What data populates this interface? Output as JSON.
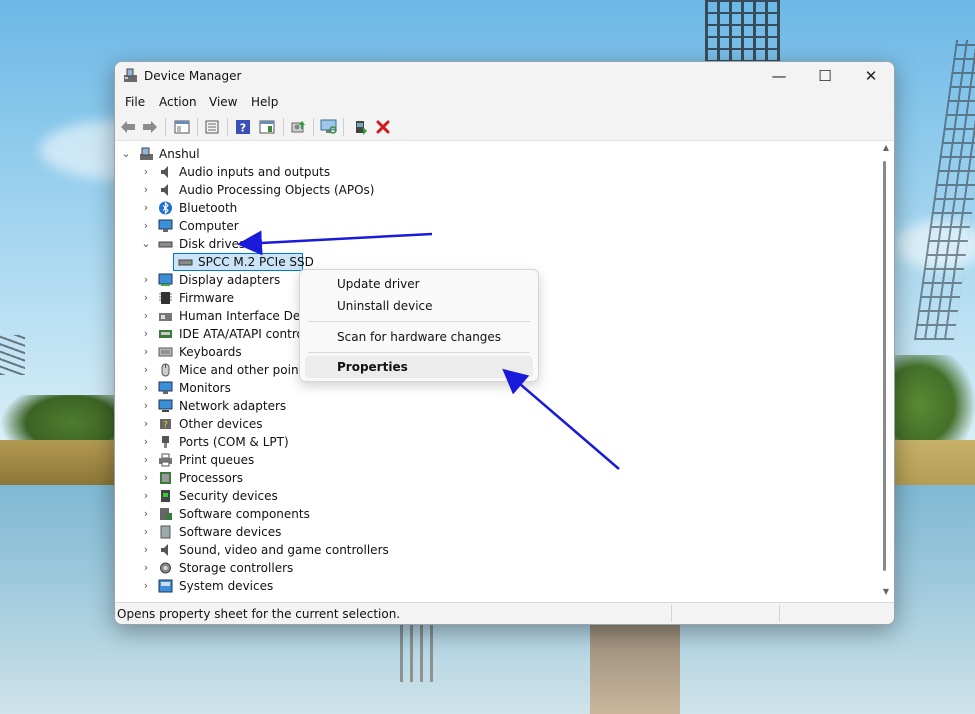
{
  "window": {
    "title": "Device Manager",
    "controls": {
      "minimize": "—",
      "maximize": "☐",
      "close": "✕"
    }
  },
  "menu": [
    "File",
    "Action",
    "View",
    "Help"
  ],
  "toolbar": {
    "buttons": [
      "back-arrow-icon",
      "forward-arrow-icon",
      "show-hide-tree-icon",
      "properties-icon",
      "help-icon",
      "show-hidden-icon",
      "update-driver-icon",
      "scan-hardware-icon",
      "add-driver-icon",
      "uninstall-icon"
    ]
  },
  "tree": {
    "root": "Anshul",
    "items": [
      {
        "label": "Audio inputs and outputs",
        "expanded": false
      },
      {
        "label": "Audio Processing Objects (APOs)",
        "expanded": false
      },
      {
        "label": "Bluetooth",
        "expanded": false
      },
      {
        "label": "Computer",
        "expanded": false
      },
      {
        "label": "Disk drives",
        "expanded": true
      },
      {
        "label": "SPCC M.2 PCIe SSD",
        "child": true,
        "selected": true
      },
      {
        "label": "Display adapters",
        "expanded": false
      },
      {
        "label": "Firmware",
        "expanded": false
      },
      {
        "label": "Human Interface Devic",
        "expanded": false
      },
      {
        "label": "IDE ATA/ATAPI controll",
        "expanded": false
      },
      {
        "label": "Keyboards",
        "expanded": false
      },
      {
        "label": "Mice and other pointin",
        "expanded": false
      },
      {
        "label": "Monitors",
        "expanded": false
      },
      {
        "label": "Network adapters",
        "expanded": false
      },
      {
        "label": "Other devices",
        "expanded": false
      },
      {
        "label": "Ports (COM & LPT)",
        "expanded": false
      },
      {
        "label": "Print queues",
        "expanded": false
      },
      {
        "label": "Processors",
        "expanded": false
      },
      {
        "label": "Security devices",
        "expanded": false
      },
      {
        "label": "Software components",
        "expanded": false
      },
      {
        "label": "Software devices",
        "expanded": false
      },
      {
        "label": "Sound, video and game controllers",
        "expanded": false
      },
      {
        "label": "Storage controllers",
        "expanded": false
      },
      {
        "label": "System devices",
        "expanded": false
      }
    ]
  },
  "context_menu": {
    "update": "Update driver",
    "uninstall": "Uninstall device",
    "scan": "Scan for hardware changes",
    "properties": "Properties"
  },
  "status": {
    "text": "Opens property sheet for the current selection."
  },
  "colors": {
    "annotation_arrow": "#1a1adb",
    "selection": "#cce4f7",
    "selection_border": "#0078d7"
  }
}
